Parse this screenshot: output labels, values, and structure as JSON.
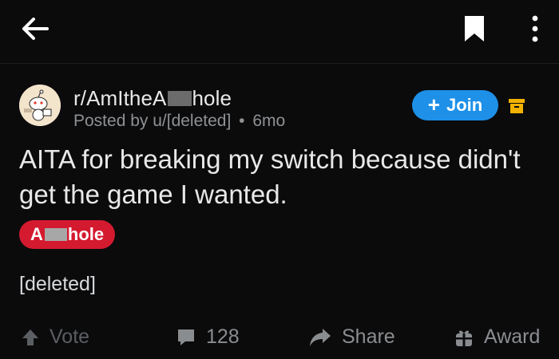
{
  "post": {
    "subreddit_prefix": "r/AmItheA",
    "subreddit_suffix": "hole",
    "posted_by": "Posted by u/[deleted]",
    "separator": "•",
    "age": "6mo",
    "join_label": "Join",
    "title": "AITA for breaking my switch because didn't get the game I wanted.",
    "flair_prefix": "A",
    "flair_suffix": "hole",
    "body": "[deleted]"
  },
  "actions": {
    "vote_label": "Vote",
    "comments_count": "128",
    "share_label": "Share",
    "award_label": "Award"
  },
  "colors": {
    "background": "#0b0b0c",
    "join": "#1e90e8",
    "flair": "#d41a2f",
    "archive": "#f2b300"
  }
}
